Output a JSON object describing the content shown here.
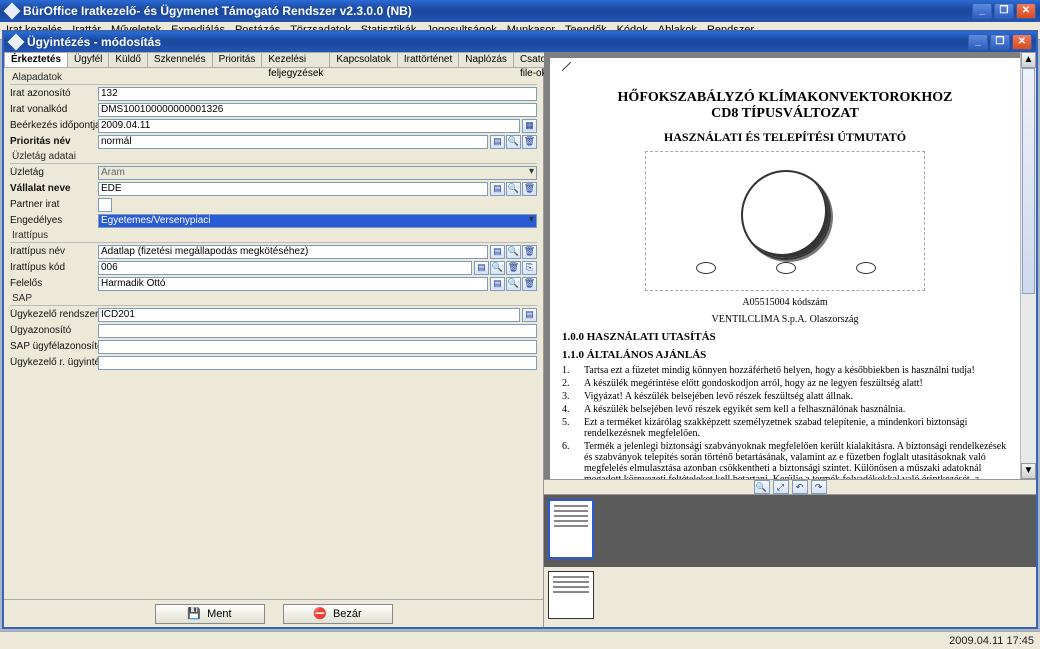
{
  "main_window": {
    "title": "BürOffice Iratkezelő- és Ügymenet Támogató Rendszer v2.3.0.0 (NB)"
  },
  "menubar": [
    "Irat kezelés",
    "Irattár",
    "Műveletek",
    "Expediálás",
    "Postázás",
    "Törzsadatok",
    "Statisztikák",
    "Jogosultságok",
    "Munkasor",
    "Teendők",
    "Kódok",
    "Ablakok",
    "Rendszer"
  ],
  "sub_window": {
    "title": "Ügyintézés - módosítás"
  },
  "tabs": [
    "Érkeztetés",
    "Ügyfél",
    "Küldő",
    "Szkennelés",
    "Prioritás",
    "Kezelési feljegyzések",
    "Kapcsolatok",
    "Irattörténet",
    "Naplózás",
    "Csatolt file-ok"
  ],
  "sections": {
    "alapadatok": "Alapadatok",
    "uzletag_adatai": "Üzletág adatai",
    "irattipus": "Irattípus",
    "sap": "SAP"
  },
  "labels": {
    "irat_azonosito": "Irat azonosító",
    "irat_vonalkod": "Irat vonalkód",
    "beerkezes_idopontja": "Beérkezés időpontja",
    "prioritas_nev": "Prioritás név",
    "uzletag": "Üzletág",
    "vallalat_neve": "Vállalat neve",
    "partner_irat": "Partner irat",
    "engedelyes": "Engedélyes",
    "irattipus_nev": "Irattípus név",
    "irattipus_kod": "Irattípus kód",
    "felelos": "Felelős",
    "ugykezelo_rendszer": "Ügykezelő rendszer",
    "ugyazonosito": "Ügyazonosító",
    "sap_ugyfelazonosito": "SAP ügyfélazonosító",
    "ugykezelo_r_ugyintezo": "Ügykezelő r. ügyintéző"
  },
  "values": {
    "irat_azonosito": "132",
    "irat_vonalkod": "DMS100100000000001326",
    "beerkezes_idopontja": "2009.04.11",
    "prioritas_nev": "normál",
    "uzletag": "Áram",
    "vallalat_neve": "EDE",
    "partner_irat": "",
    "engedelyes": "Egyetemes/Versenypiaci",
    "irattipus_nev": "Adatlap (fizetési megállapodás megkötéséhez)",
    "irattipus_kod": "006",
    "felelos": "Harmadik Ottó",
    "ugykezelo_rendszer": "ICD201",
    "ugyazonosito": "",
    "sap_ugyfelazonosito": "",
    "ugykezelo_r_ugyintezo": ""
  },
  "buttons": {
    "ment": "Ment",
    "bezar": "Bezár"
  },
  "status": {
    "datetime": "2009.04.11 17:45"
  },
  "doc": {
    "title1": "HŐFOKSZABÁLYZÓ KLÍMAKONVEKTOROKHOZ",
    "title2": "CD8 TÍPUSVÁLTOZAT",
    "subtitle": "HASZNÁLATI ÉS TELEPÍTÉSI ÚTMUTATÓ",
    "code": "A05515004 kódszám",
    "company": "VENTILCLIMA S.p.A. Olaszország",
    "sec100": "1.0.0 HASZNÁLATI UTASÍTÁS",
    "sec110": "1.1.0 ÁLTALÁNOS AJÁNLÁS",
    "list": [
      "Tartsa ezt a füzetet mindig könnyen hozzáférhető helyen, hogy a későbbiekben is használni tudja!",
      "A készülék megérintése előtt gondoskodjon arról, hogy az ne legyen feszültség alatt!",
      "Vigyázat! A készülék belsejében levő részek feszültség alatt állnak.",
      "A készülék belsejében levő részek egyikét sem kell a felhasználónak használnia.",
      "Ezt a terméket kizárólag szakképzett személyzetnek szabad telepítenie, a mindenkori biztonsági rendelkezésnek megfelelően.",
      "Termék a jelenlegi biztonsági szabványoknak megfelelően került kialakításra. A biztonsági rendelkezések és szabványok telepítés során történő betartásának, valamint az e füzetben foglalt utasításoknak való megfelelés elmulasztása azonban csökkentheti a biztonsági szintet. Különösen a műszaki adatoknál megadott környezeti feltételeket kell betartani. Kerülje a termék folyadékokkal való érintkezését, a kondenzálódás kialakulását, korrozív folyadékok"
    ]
  }
}
